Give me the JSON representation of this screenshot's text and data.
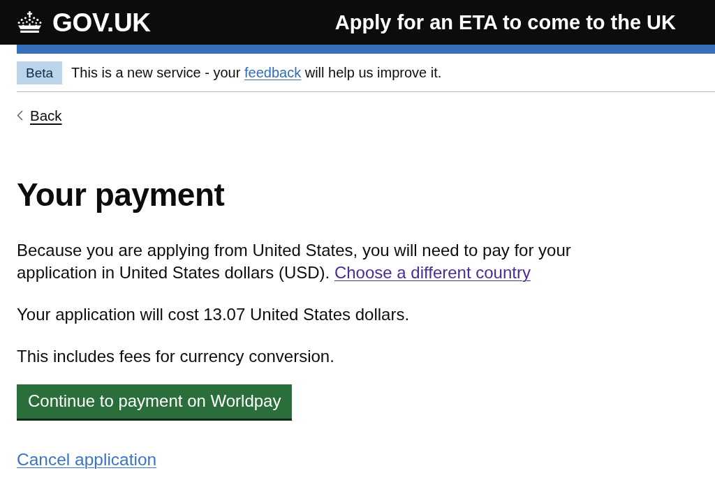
{
  "header": {
    "logo_text": "GOV.UK",
    "service_name": "Apply for an ETA to come to the UK"
  },
  "phase_banner": {
    "tag": "Beta",
    "text_before": "This is a new service - your ",
    "link": {
      "text": "feedback",
      "visited": false
    },
    "text_after": " will help us improve it."
  },
  "back_link": "Back",
  "heading": "Your payment",
  "paragraphs": [
    {
      "text": "Because you are applying from United States, you will need to pay for your application in United States dollars (USD).",
      "link": {
        "text": "Choose a different country",
        "visited": true
      }
    },
    {
      "text": "Your application will cost 13.07 United States dollars."
    },
    {
      "text": "This includes fees for currency conversion."
    }
  ],
  "primary_button": "Continue to payment on Worldpay",
  "cancel_link": {
    "text": "Cancel application",
    "visited": false
  }
}
